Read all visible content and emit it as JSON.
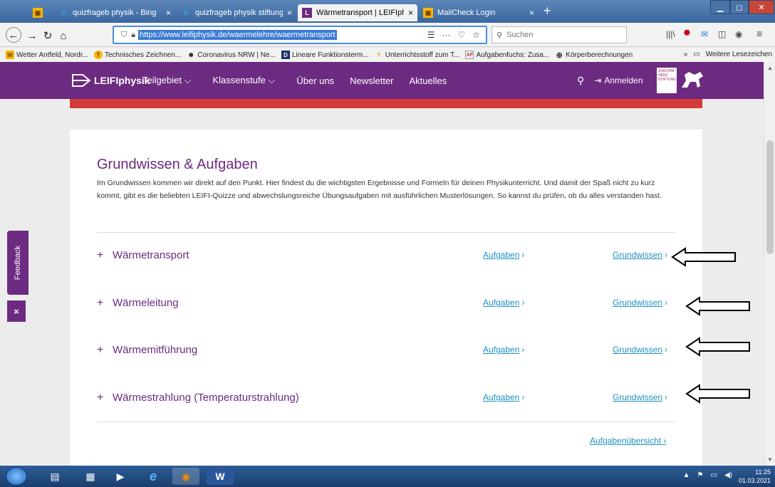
{
  "browser": {
    "tabs": [
      {
        "label": "",
        "favicon": "mailcheck-icon",
        "active": false
      },
      {
        "label": "quizfrageb physik - Bing",
        "favicon": "bing-icon",
        "active": false
      },
      {
        "label": "quizfrageb physik stiftung - Bin",
        "favicon": "bing-icon",
        "active": false
      },
      {
        "label": "Wärmetransport | LEIFIphysik",
        "favicon": "leifi-icon",
        "active": true
      },
      {
        "label": "MailCheck Login",
        "favicon": "mailcheck-icon",
        "active": false
      }
    ],
    "new_tab": "+",
    "close": "×",
    "url": "https://www.leifiphysik.de/waermelehre/waermetransport",
    "url_right_icons": [
      "☰",
      "···",
      "♡",
      "☆"
    ],
    "search_placeholder": "Suchen",
    "bookmarks": [
      {
        "label": "Wetter Antfeld, Nordr...",
        "icon": "W"
      },
      {
        "label": "Technisches Zeichnen...",
        "icon": "T"
      },
      {
        "label": "Coronavirus NRW | Ne...",
        "icon": "✺"
      },
      {
        "label": "Lineare Funktionsterm...",
        "icon": "D"
      },
      {
        "label": "Unterrichtsstoff zum T...",
        "icon": "Y"
      },
      {
        "label": "Aufgabenfuchs: Zusa...",
        "icon": "AF"
      },
      {
        "label": "Körperberechnungen",
        "icon": "⊕"
      }
    ],
    "bookmarks_more": "»",
    "other_bookmarks": "Weitere Lesezeichen"
  },
  "site": {
    "logo": "LEIFIphysik",
    "nav": [
      {
        "label": "Teilgebiet",
        "dropdown": true
      },
      {
        "label": "Klassenstufe",
        "dropdown": true
      },
      {
        "label": "Über uns",
        "dropdown": false
      },
      {
        "label": "Newsletter",
        "dropdown": false
      },
      {
        "label": "Aktuelles",
        "dropdown": false
      }
    ],
    "login": "Anmelden",
    "sponsor": "JOACHIM HERZ STIFTUNG",
    "accent_color": "#6c2a80",
    "link_color": "#1f8fc1"
  },
  "main": {
    "title": "Grundwissen & Aufgaben",
    "intro": "Im Grundwissen kommen wir direkt auf den Punkt. Hier findest du die wichtigsten Ergebnisse und Formeln für deinen Physikunterricht. Und damit der Spaß nicht zu kurz kommt, gibt es die beliebten LEIFI-Quizze und abwechslungsreiche Übungsaufgaben mit ausführlichen Musterlösungen. So kannst du prüfen, ob du alles verstanden hast.",
    "topics": [
      {
        "title": "Wärmetransport",
        "aufgaben": "Aufgaben",
        "grundwissen": "Grundwissen"
      },
      {
        "title": "Wärmeleitung",
        "aufgaben": "Aufgaben",
        "grundwissen": "Grundwissen"
      },
      {
        "title": "Wärmemitführung",
        "aufgaben": "Aufgaben",
        "grundwissen": "Grundwissen"
      },
      {
        "title": "Wärmestrahlung (Temperaturstrahlung)",
        "aufgaben": "Aufgaben",
        "grundwissen": "Grundwissen"
      }
    ],
    "overview_link": "Aufgabenübersicht"
  },
  "feedback": {
    "label": "Feedback",
    "close": "×"
  },
  "taskbar": {
    "time": "11:25",
    "date": "01.03.2021"
  }
}
